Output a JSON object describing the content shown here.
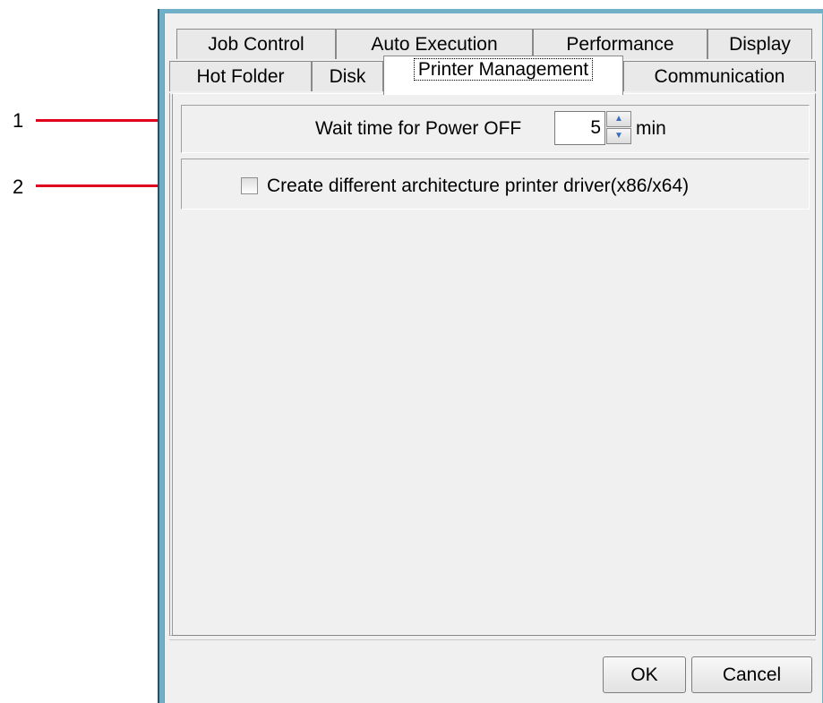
{
  "callouts": [
    {
      "number": "1"
    },
    {
      "number": "2"
    }
  ],
  "tabs": {
    "row1": [
      {
        "label": "Job Control"
      },
      {
        "label": "Auto Execution"
      },
      {
        "label": "Performance"
      },
      {
        "label": "Display"
      }
    ],
    "row2": [
      {
        "label": "Hot Folder"
      },
      {
        "label": "Disk"
      },
      {
        "label": "Printer Management",
        "selected": true
      },
      {
        "label": "Communication"
      }
    ]
  },
  "printer_management": {
    "power_off_wait": {
      "label": "Wait time for Power OFF",
      "value": "5",
      "unit": "min"
    },
    "architecture_driver": {
      "label": "Create different architecture printer driver(x86/x64)",
      "checked": false
    }
  },
  "buttons": {
    "ok": "OK",
    "cancel": "Cancel"
  },
  "colors": {
    "callout_line": "#e0001b",
    "window_frame": "#6fb0c8",
    "dialog_bg": "#f0f0f0"
  }
}
